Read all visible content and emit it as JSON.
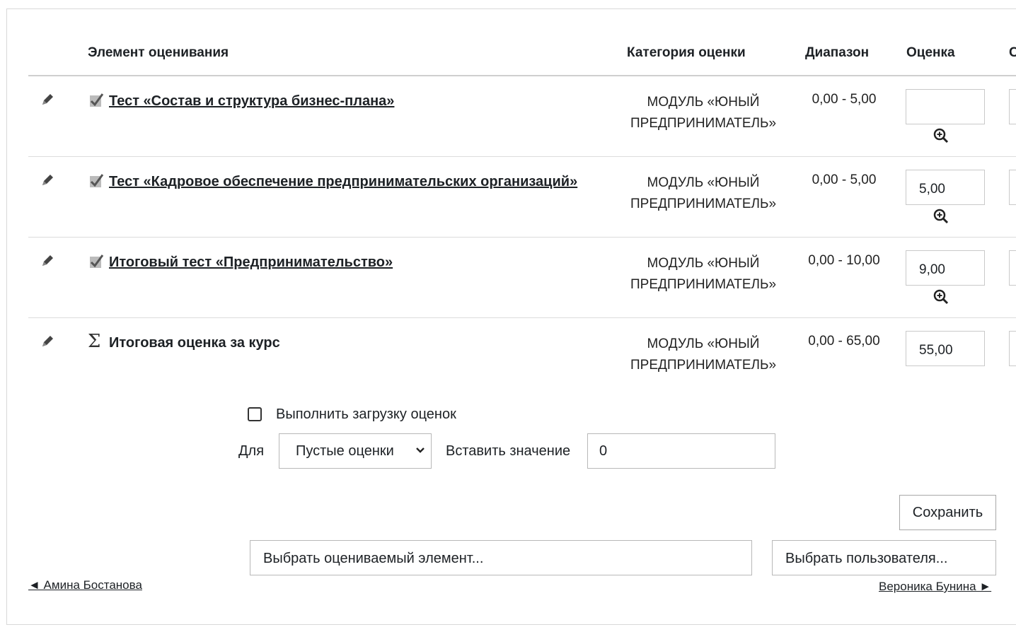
{
  "table": {
    "headers": {
      "item": "Элемент оценивания",
      "category": "Категория оценки",
      "range": "Диапазон",
      "grade": "Оценка",
      "cut": "С"
    },
    "rows": [
      {
        "icon": "quiz-icon",
        "name": "Тест «Состав и структура бизнес-плана»",
        "category": "МОДУЛЬ «ЮНЫЙ ПРЕДПРИНИМАТЕЛЬ»",
        "range": "0,00 - 5,00",
        "grade": ""
      },
      {
        "icon": "quiz-icon",
        "name": "Тест «Кадровое обеспечение предпринимательских организаций»",
        "category": "МОДУЛЬ «ЮНЫЙ ПРЕДПРИНИМАТЕЛЬ»",
        "range": "0,00 - 5,00",
        "grade": "5,00"
      },
      {
        "icon": "quiz-icon",
        "name": "Итоговый тест «Предпринимательство»",
        "category": "МОДУЛЬ «ЮНЫЙ ПРЕДПРИНИМАТЕЛЬ»",
        "range": "0,00 - 10,00",
        "grade": "9,00"
      },
      {
        "icon": "sigma-icon",
        "name": "Итоговая оценка за курс",
        "category": "МОДУЛЬ «ЮНЫЙ ПРЕДПРИНИМАТЕЛЬ»",
        "range": "0,00 - 65,00",
        "grade": "55,00"
      }
    ]
  },
  "bulk": {
    "checkbox_label": "Выполнить загрузку оценок",
    "checked": false,
    "for_label": "Для",
    "select_value": "Пустые оценки",
    "insert_label": "Вставить значение",
    "insert_value": "0"
  },
  "actions": {
    "save_label": "Сохранить"
  },
  "selectors": {
    "item_placeholder": "Выбрать оцениваемый элемент...",
    "user_placeholder": "Выбрать пользователя..."
  },
  "nav": {
    "prev": "◄ Амина Бостанова",
    "next": "Вероника Бунина ►"
  },
  "colors": {
    "text": "#1d2125",
    "border": "#c9c9c9",
    "background": "#ffffff"
  }
}
